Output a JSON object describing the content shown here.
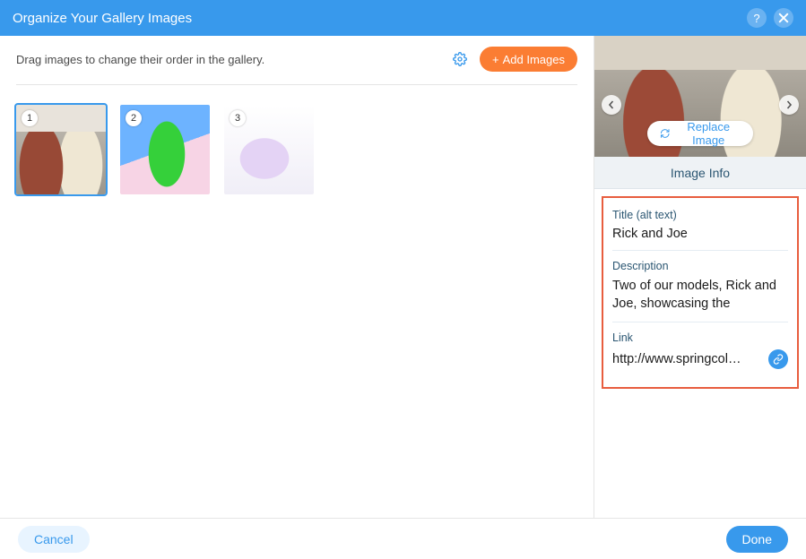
{
  "header": {
    "title": "Organize Your Gallery Images"
  },
  "left": {
    "hint": "Drag images to change their order in the gallery.",
    "add_label": "Add Images",
    "thumbs": [
      {
        "index": "1"
      },
      {
        "index": "2"
      },
      {
        "index": "3"
      }
    ]
  },
  "right": {
    "replace_label": "Replace Image",
    "section_title": "Image Info",
    "title_field": {
      "label": "Title (alt text)",
      "value": "Rick and Joe"
    },
    "description_field": {
      "label": "Description",
      "value": "Two of our models, Rick and Joe, showcasing the"
    },
    "link_field": {
      "label": "Link",
      "value": "http://www.springcol…"
    }
  },
  "footer": {
    "cancel": "Cancel",
    "done": "Done"
  }
}
